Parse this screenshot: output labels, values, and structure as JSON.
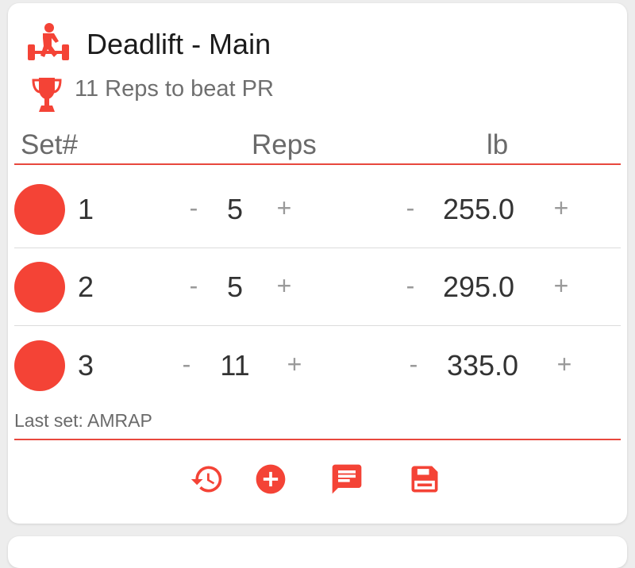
{
  "exercise": {
    "title": "Deadlift - Main",
    "pr_message": "11 Reps to beat PR"
  },
  "table": {
    "headers": {
      "set": "Set#",
      "reps": "Reps",
      "weight": "lb"
    },
    "minus_label": "-",
    "plus_label": "+",
    "rows": [
      {
        "set": "1",
        "reps": "5",
        "weight": "255.0",
        "status_color": "#f44336"
      },
      {
        "set": "2",
        "reps": "5",
        "weight": "295.0",
        "status_color": "#f44336"
      },
      {
        "set": "3",
        "reps": "11",
        "weight": "335.0",
        "status_color": "#f44336"
      }
    ]
  },
  "note": "Last set: AMRAP",
  "toolbar": {
    "icons": [
      "history-icon",
      "add-circle-icon",
      "comment-icon",
      "save-icon"
    ]
  },
  "colors": {
    "accent": "#f44336",
    "divider_red": "#e8483e"
  }
}
